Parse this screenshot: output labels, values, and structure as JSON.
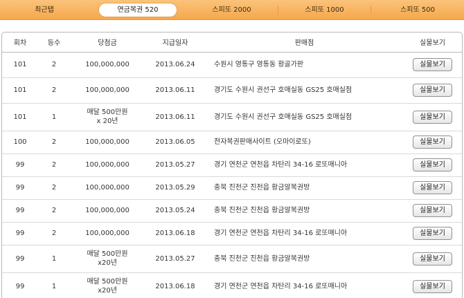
{
  "tabs": [
    {
      "label": "최근탭"
    },
    {
      "label": "연금복권 520"
    },
    {
      "label": "스피또 2000"
    },
    {
      "label": "스피또 1000"
    },
    {
      "label": "스피또 500"
    }
  ],
  "active_tab": 1,
  "table": {
    "headers": [
      "회차",
      "등수",
      "당첨금",
      "지급일자",
      "판매점",
      "실물보기"
    ],
    "button_label": "실물보기",
    "rows": [
      {
        "round": "101",
        "rank": "2",
        "prize": [
          "100,000,000"
        ],
        "date": "2013.06.24",
        "shop": "수원시 영통구 영통동 황골가판",
        "h": "r1"
      },
      {
        "round": "101",
        "rank": "2",
        "prize": [
          "100,000,000"
        ],
        "date": "2013.06.11",
        "shop": "경기도 수원시 권선구 호매실동 GS25 호매실점",
        "h": "r1"
      },
      {
        "round": "101",
        "rank": "1",
        "prize": [
          "매달 500만원",
          "x 20년"
        ],
        "date": "2013.06.11",
        "shop": "경기도 수원시 권선구 호매실동 GS25 호매실점",
        "h": "r3"
      },
      {
        "round": "100",
        "rank": "2",
        "prize": [
          "100,000,000"
        ],
        "date": "2013.06.05",
        "shop": "전자복권판매사이트 (오마이로또)",
        "h": "r2"
      },
      {
        "round": "99",
        "rank": "2",
        "prize": [
          "100,000,000"
        ],
        "date": "2013.05.27",
        "shop": "경기 연천군 연천읍 차탄리 34-16 로또매니아",
        "h": "r2"
      },
      {
        "round": "99",
        "rank": "2",
        "prize": [
          "100,000,000"
        ],
        "date": "2013.05.29",
        "shop": "충북 진천군 진천읍 황금알복권방",
        "h": "r2"
      },
      {
        "round": "99",
        "rank": "2",
        "prize": [
          "100,000,000"
        ],
        "date": "2013.05.24",
        "shop": "충북 진천군 진천읍 황금알복권방",
        "h": "r2"
      },
      {
        "round": "99",
        "rank": "2",
        "prize": [
          "100,000,000"
        ],
        "date": "2013.06.18",
        "shop": "경기 연천군 연천읍 차탄리 34-16 로또매니아",
        "h": "r2"
      },
      {
        "round": "99",
        "rank": "1",
        "prize": [
          "매달 500만원",
          "x20년"
        ],
        "date": "2013.05.27",
        "shop": "충북 진천군 진천읍 황금알복권방",
        "h": "r3"
      },
      {
        "round": "99",
        "rank": "1",
        "prize": [
          "매달 500만원",
          "x20년"
        ],
        "date": "2013.06.18",
        "shop": "경기 연천군 연천읍 차탄리 34-16 로또매니아",
        "h": "r3"
      }
    ]
  }
}
